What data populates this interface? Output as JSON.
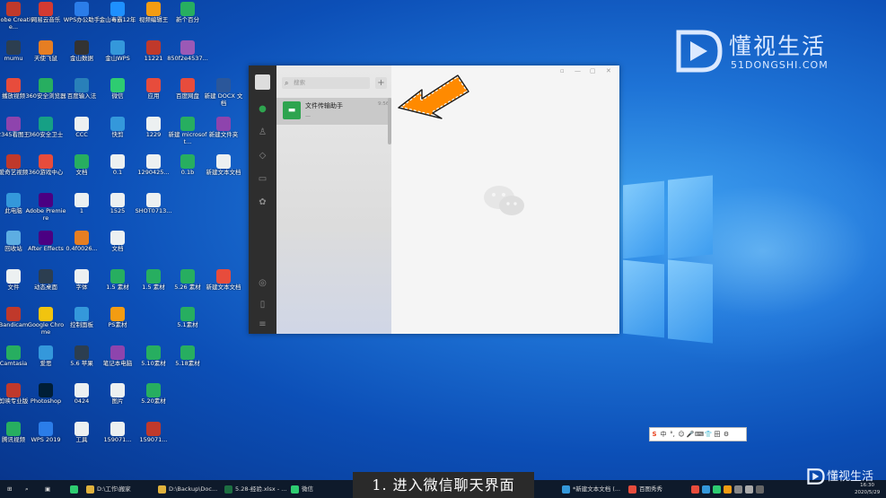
{
  "desktop_icons": [
    {
      "label": "Adobe Creative...",
      "color": "#c0392b"
    },
    {
      "label": "网易云音乐",
      "color": "#d33a31"
    },
    {
      "label": "WPS办公助手",
      "color": "#2b7de9"
    },
    {
      "label": "金山毒霸12年",
      "color": "#1e90ff"
    },
    {
      "label": "视频编辑王",
      "color": "#f39c12"
    },
    {
      "label": "新个百分",
      "color": "#27ae60"
    },
    {
      "label": "mumu",
      "color": "#2c3e50"
    },
    {
      "label": "天使飞鼠",
      "color": "#e67e22"
    },
    {
      "label": "金山数据",
      "color": "#333333"
    },
    {
      "label": "金山WPS",
      "color": "#3498db"
    },
    {
      "label": "11221",
      "color": "#c0392b"
    },
    {
      "label": "850f2e4537...",
      "color": "#9b59b6"
    },
    {
      "label": "播放视频",
      "color": "#e74c3c"
    },
    {
      "label": "360安全浏览器",
      "color": "#27ae60"
    },
    {
      "label": "百度输入法",
      "color": "#2980b9"
    },
    {
      "label": "微信",
      "color": "#2ecc71"
    },
    {
      "label": "应用",
      "color": "#e74c3c"
    },
    {
      "label": "百度网盘",
      "color": "#e74c3c"
    },
    {
      "label": "新建 DOCX 文档",
      "color": "#2b579a"
    },
    {
      "label": "2345看图王",
      "color": "#8e44ad"
    },
    {
      "label": "360安全卫士",
      "color": "#16a085"
    },
    {
      "label": "CCC",
      "color": "#ecf0f1"
    },
    {
      "label": "快剪",
      "color": "#3498db"
    },
    {
      "label": "1229",
      "color": "#ecf0f1"
    },
    {
      "label": "新建 microsoft...",
      "color": "#27ae60"
    },
    {
      "label": "新建文件夹",
      "color": "#8e44ad"
    },
    {
      "label": "爱奇艺视频",
      "color": "#c0392b"
    },
    {
      "label": "360游戏中心",
      "color": "#e74c3c"
    },
    {
      "label": "文档",
      "color": "#27ae60"
    },
    {
      "label": "0.1",
      "color": "#ecf0f1"
    },
    {
      "label": "1290425...",
      "color": "#ecf0f1"
    },
    {
      "label": "0.1b",
      "color": "#27ae60"
    },
    {
      "label": "新建文本文档",
      "color": "#ecf0f1"
    },
    {
      "label": "此电脑",
      "color": "#3498db"
    },
    {
      "label": "Adobe Premiere",
      "color": "#4b0082"
    },
    {
      "label": "1",
      "color": "#ecf0f1"
    },
    {
      "label": "1525",
      "color": "#ecf0f1"
    },
    {
      "label": "SHOT0713...",
      "color": "#ecf0f1"
    },
    {
      "label": "回收站",
      "color": "#5dade2"
    },
    {
      "label": "After Effects",
      "color": "#4b0082"
    },
    {
      "label": "0.4f0026...",
      "color": "#e67e22"
    },
    {
      "label": "文档",
      "color": "#ecf0f1"
    },
    {
      "label": "文件",
      "color": "#ecf0f1"
    },
    {
      "label": "动态桌面",
      "color": "#2c3e50"
    },
    {
      "label": "字体",
      "color": "#ecf0f1"
    },
    {
      "label": "1.5 素材",
      "color": "#27ae60"
    },
    {
      "label": "1.5 素材",
      "color": "#27ae60"
    },
    {
      "label": "5.26 素材",
      "color": "#27ae60"
    },
    {
      "label": "新建文本文档",
      "color": "#e74c3c"
    },
    {
      "label": "Bandicam",
      "color": "#c0392b"
    },
    {
      "label": "Google Chrome",
      "color": "#f1c40f"
    },
    {
      "label": "控制面板",
      "color": "#3498db"
    },
    {
      "label": "PS素材",
      "color": "#f39c12"
    },
    {
      "label": "5.1素材",
      "color": "#27ae60"
    },
    {
      "label": "Camtasia",
      "color": "#27ae60"
    },
    {
      "label": "爱思",
      "color": "#3498db"
    },
    {
      "label": "5.6 苹果",
      "color": "#2c3e50"
    },
    {
      "label": "笔记本电脑",
      "color": "#8e44ad"
    },
    {
      "label": "5.10素材",
      "color": "#27ae60"
    },
    {
      "label": "5.18素材",
      "color": "#27ae60"
    },
    {
      "label": "剪映专业版",
      "color": "#c0392b"
    },
    {
      "label": "Photoshop",
      "color": "#001e36"
    },
    {
      "label": "0424",
      "color": "#ecf0f1"
    },
    {
      "label": "图片",
      "color": "#ecf0f1"
    },
    {
      "label": "5.20素材",
      "color": "#27ae60"
    },
    {
      "label": "腾讯视频",
      "color": "#27ae60"
    },
    {
      "label": "WPS 2019",
      "color": "#2b7de9"
    },
    {
      "label": "工具",
      "color": "#ecf0f1"
    },
    {
      "label": "159071...",
      "color": "#ecf0f1"
    },
    {
      "label": "159071...",
      "color": "#c0392b"
    }
  ],
  "watermark": {
    "title": "懂视生活",
    "url": "51DONGSHI.COM",
    "small": "懂视生活"
  },
  "wechat": {
    "search_placeholder": "搜索",
    "add_label": "+",
    "chat_items": [
      {
        "name": "文件传输助手",
        "preview": "一",
        "time": "9:56"
      }
    ],
    "window_controls": [
      "▫",
      "—",
      "▢",
      "✕"
    ]
  },
  "ime": {
    "items": [
      "S",
      "中",
      "°,",
      "☺",
      "🎤",
      "⌨",
      "👕",
      "田",
      "⚙"
    ]
  },
  "taskbar": {
    "items": [
      {
        "label": "D:\\工作\\搬家",
        "color": "#e0b23c"
      },
      {
        "label": "D:\\Backup\\Doc...",
        "color": "#e0b23c"
      },
      {
        "label": "5.28-经验.xlsx - ...",
        "color": "#1d6f42"
      },
      {
        "label": "微信",
        "color": "#2ecc71"
      },
      {
        "label": "*新建文本文档 (...",
        "color": "#3498db"
      },
      {
        "label": "百图秀秀",
        "color": "#e74c3c"
      }
    ],
    "caption": "1. 进入微信聊天界面",
    "clock_time": "16:30",
    "clock_date": "2020/5/29"
  },
  "colors": {
    "wechat_green": "#2ea44f",
    "arrow_orange": "#ff8a00",
    "taskbar": "#0e1a2b"
  }
}
